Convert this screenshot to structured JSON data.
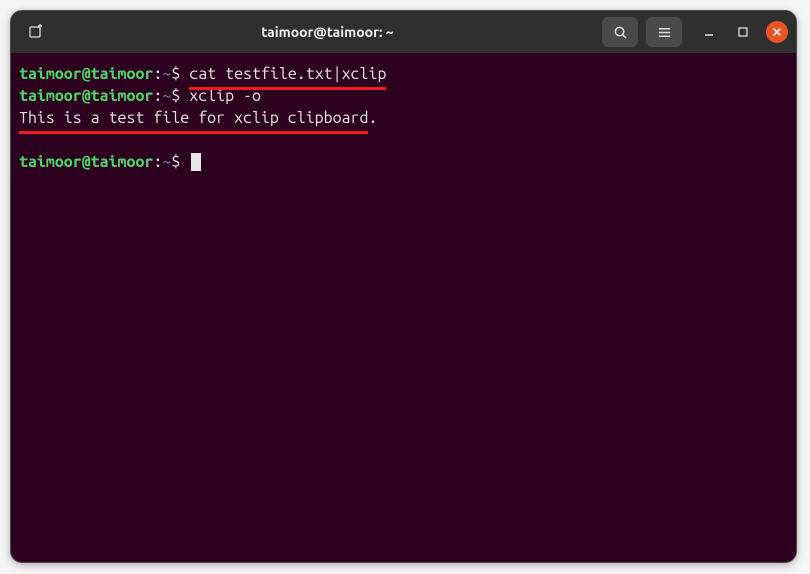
{
  "titlebar": {
    "title": "taimoor@taimoor: ~"
  },
  "terminal": {
    "user_host": "taimoor@taimoor",
    "colon": ":",
    "cwd": "~",
    "prompt_symbol": "$",
    "line1_cmd": "cat testfile.txt|xclip",
    "line2_cmd": "xclip -o",
    "output": "This is a test file for xclip clipboard",
    "output_period": "."
  }
}
